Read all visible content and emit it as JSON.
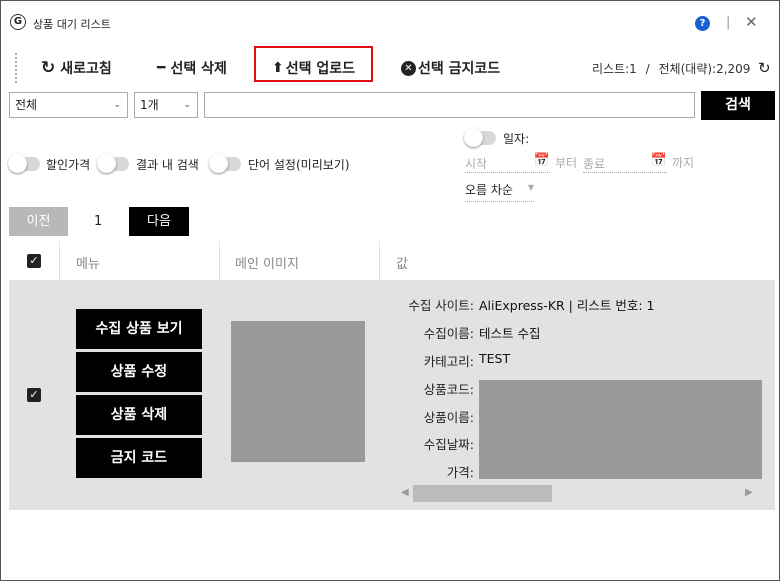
{
  "window": {
    "title": "상품 대기 리스트",
    "help": "?",
    "separator": "|",
    "close": "✕"
  },
  "toolbar": {
    "refresh": "새로고침",
    "delete_selected": "선택 삭제",
    "upload_selected": "선택 업로드",
    "banned_code": "선택 금지코드",
    "list_count_label": "리스트:1",
    "divider": "/",
    "total_label": "전체(대략):2,209"
  },
  "search": {
    "scope_value": "전체",
    "count_value": "1개",
    "query": "",
    "button": "검색"
  },
  "filters": {
    "discount_price": "할인가격",
    "search_in_results": "결과 내 검색",
    "word_settings": "단어 설정(미리보기)",
    "date_label": "일자:",
    "start_placeholder": "시작",
    "from": "부터",
    "end_placeholder": "종료",
    "until": "까지",
    "sort_value": "오름 차순"
  },
  "pager": {
    "prev": "이전",
    "page": "1",
    "next": "다음"
  },
  "table": {
    "headers": {
      "menu": "메뉴",
      "main_image": "메인 이미지",
      "value": "값"
    },
    "row": {
      "actions": [
        "수집 상품 보기",
        "상품 수정",
        "상품 삭제",
        "금지 코드"
      ],
      "fields": [
        {
          "label": "수집 사이트:",
          "value": "AliExpress-KR | 리스트 번호: 1"
        },
        {
          "label": "수집이름:",
          "value": "테스트 수집"
        },
        {
          "label": "카테고리:",
          "value": "TEST"
        },
        {
          "label": "상품코드:",
          "value": ""
        },
        {
          "label": "상품이름:",
          "value": ""
        },
        {
          "label": "수집날짜:",
          "value": ""
        },
        {
          "label": "가격:",
          "value": ""
        }
      ]
    }
  },
  "colors": {
    "highlight_border": "#e01010",
    "button_black": "#000000",
    "row_bg": "#e2e2e2",
    "help_blue": "#1a5fd0"
  }
}
